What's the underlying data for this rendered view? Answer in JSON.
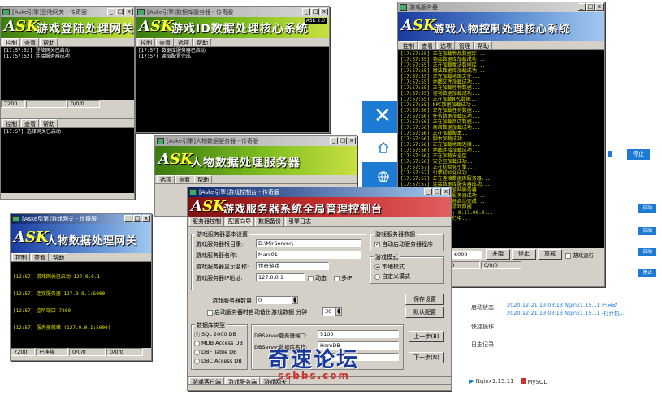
{
  "colors": {
    "accent_blue": "#1e7bd4",
    "console_text": "#e0e000",
    "banner_green": "#3a7a10",
    "banner_blue": "#1a3aa0",
    "file_icon_red": "#d0302a"
  },
  "back_panel": {
    "nav_icons": [
      "close-icon",
      "home-icon",
      "globe-icon"
    ],
    "header_button": "停止",
    "side_buttons": [
      "启动",
      "启动",
      "启动",
      "停止"
    ],
    "rows": [
      {
        "label": "运行状态",
        "time": "2020-12-21 13:03:13",
        "text": "Nginx1.15.11 已启动"
      },
      {
        "label": "",
        "time": "2020-12-21 13:03:13",
        "text": "Nginx1.15.11 -打开执..."
      }
    ],
    "row_labels": [
      "启动状态",
      "快捷操作",
      "日志记录"
    ],
    "services": [
      {
        "name": "Nginx1.15.11",
        "icon": "play-icon"
      },
      {
        "name": "MySQL",
        "icon": "file-icon"
      }
    ]
  },
  "login_gate": {
    "title": "[Aske引擎]登陆网关 - 传奇服",
    "banner": "游戏登陆处理网关",
    "version": "",
    "tabs": [
      "控制",
      "查看",
      "帮助"
    ],
    "lines": [
      "[17:57:52] 登陆网关已启动",
      "[17:57:52] 连接服务器成功"
    ],
    "status": [
      "7200",
      "",
      "0/0/0"
    ]
  },
  "db_server": {
    "title": "[Aske引擎]数据库服务器 - 传奇服",
    "banner": "游戏ID数据处理核心系统",
    "version": "ASK 2.0",
    "tabs": [
      "控制",
      "查看",
      "选项",
      "帮助"
    ],
    "lines": [
      "[17:57] 数据库服务器已启动",
      "[17:57] 读取配置完成"
    ]
  },
  "sel_gate": {
    "title": "",
    "tabs": [
      "控制",
      "查看",
      "帮助"
    ],
    "lines": [
      "[17:57] 选择网关已启动"
    ]
  },
  "m2_server": {
    "title": "游戏服务器",
    "banner": "游戏人物控制处理核心系统",
    "version": "",
    "tabs": [
      "控制",
      "查看",
      "选项",
      "管理",
      "帮助"
    ],
    "lines": [
      "[17:57:55] 正在加载物品数据库...",
      "[17:57:55] 物品数据库加载成功...",
      "[17:57:55] 正在加载魔法数据库...",
      "[17:57:55] 魔法数据库加载成功...",
      "[17:57:55] 正在加载地图文件...",
      "[17:57:55] 地图文件加载成功...",
      "[17:57:55] 正在加载怪物数据...",
      "[17:57:55] 怪物数据加载成功...",
      "[17:57:55] 正在加载NPC数据...",
      "[17:57:55] NPC数据加载成功...",
      "[17:57:56] 正在加载任务数据...",
      "[17:57:56] 任务数据加载成功...",
      "[17:57:56] 正在加载商店数据...",
      "[17:57:56] 商店数据加载成功...",
      "[17:57:56] 正在加载脚本...",
      "[17:57:56] 脚本加载成功...",
      "[17:57:56] 正在加载地图连接...",
      "[17:57:56] 地图连接加载成功...",
      "[17:57:56] 正在加载安全区...",
      "[17:57:56] 安全区加载成功...",
      "[17:57:57] 正在初始化引擎...",
      "[17:57:57] 引擎初始化成功...",
      "[17:57:57] 正在连接数据库服务器...",
      "[17:57:57] 连接数据库服务器成功...",
      "[17:57:57] 正在连接登陆服务器...",
      "[17:57:57] 连接登陆服务器成功...",
      "[17:57:58] 游戏服务器启动完成...",
      "[17:57:58] 开始处理游戏数据...",
      "[17:57:58] 当前版本: 0.17.00.0...",
      "[17:57:58] 服务器运行中..."
    ],
    "bottom_value": "6000",
    "bottom_buttons": [
      "开始",
      "停止",
      "重载"
    ],
    "bottom_check": "游戏运行",
    "status": [
      "",
      "0",
      "0/0/0"
    ]
  },
  "data_server": {
    "title": "[Aske引擎]人物数据服务器 - 传奇服",
    "banner": "人物数据处理服务器",
    "tabs": [
      "选项",
      "查看",
      "帮助"
    ]
  },
  "data_gate": {
    "title": "[Aske引擎]游戏网关 - 传奇服",
    "banner": "人物数据处理网关",
    "tabs": [
      "控制",
      "查看",
      "帮助"
    ],
    "lines": [
      "[12:57] 游戏网关已启动 127.0.0.1",
      "[12:57] 连接服务器 127.0.0.1:5000",
      "[12:57] 监听端口 7200",
      "[12:57] 服务器就绪 (127.0.0.1:5000)"
    ],
    "status": [
      "7200",
      "已连接",
      "0/0/0",
      "0/0/0"
    ]
  },
  "control": {
    "title": "[Aske引擎]游戏控制台 - 传奇服",
    "banner": "游戏服务器系统全局管理控制台",
    "tabs": [
      "服务器控制",
      "配置向导",
      "数据备份",
      "引擎日志"
    ],
    "group_title": "游戏服务器基本设置",
    "fields": [
      {
        "label": "游戏服务器根目录:",
        "value": "D:\\MirServer\\"
      },
      {
        "label": "游戏服务器名称:",
        "value": "Mars01"
      },
      {
        "label": "游戏服务器显示名称:",
        "value": "传奇游戏"
      },
      {
        "label": "游戏服务器IP地址:",
        "value": "127.0.0.1"
      }
    ],
    "ip_checks": [
      "动态",
      "多IP"
    ],
    "db_group": {
      "title": "游戏服务器数据",
      "check": "自动启动服务器程序"
    },
    "mode_group": {
      "title": "游戏模式",
      "options": [
        "本地模式",
        "自定义模式"
      ],
      "selected": 0
    },
    "count_label": "游戏服务器数量:",
    "count_value": "0",
    "check2": "启动服务器时自动备份游戏数据 分钟",
    "minutes": "30",
    "right_buttons": [
      "保存设置",
      "默认配置"
    ],
    "db_type_group": {
      "title": "数据库类型",
      "options": [
        "SQL 2000 DB",
        "MDB Access DB",
        "DBF Table DB",
        "DBC Access DB"
      ],
      "selected": 0
    },
    "db_fields": [
      {
        "label": "DBServer服务器端口:",
        "value": "5100"
      },
      {
        "label": "DBServer数据库名称:",
        "value": "HeroDB"
      },
      {
        "label": "",
        "value": ""
      }
    ],
    "nav_buttons": [
      "上一步(B)",
      "下一步(N)"
    ],
    "bottom_tabs": [
      "游戏客户端",
      "游戏服务端",
      "游戏网关"
    ]
  },
  "watermark": {
    "main": "奇速论坛",
    "sub": "ssbbs.com"
  }
}
